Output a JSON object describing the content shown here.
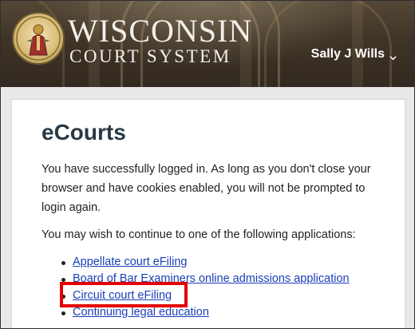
{
  "header": {
    "brand_line1": "WISCONSIN",
    "brand_line2": "COURT SYSTEM",
    "user_name": "Sally J Wills",
    "user_menu_icon": "chevron-down-icon",
    "seal_icon": "court-seal-logo"
  },
  "main": {
    "title": "eCourts",
    "login_message": "You have successfully logged in. As long as you don't close your browser and have cookies enabled, you will not be prompted to login again.",
    "apps_intro": "You may wish to continue to one of the following applications:",
    "applications": [
      {
        "label": "Appellate court eFiling"
      },
      {
        "label": "Board of Bar Examiners online admissions application"
      },
      {
        "label": "Circuit court eFiling"
      },
      {
        "label": "Continuing legal education"
      }
    ]
  },
  "colors": {
    "link": "#1a3fb8",
    "highlight_box": "#e30000",
    "title": "#2a3a44"
  }
}
